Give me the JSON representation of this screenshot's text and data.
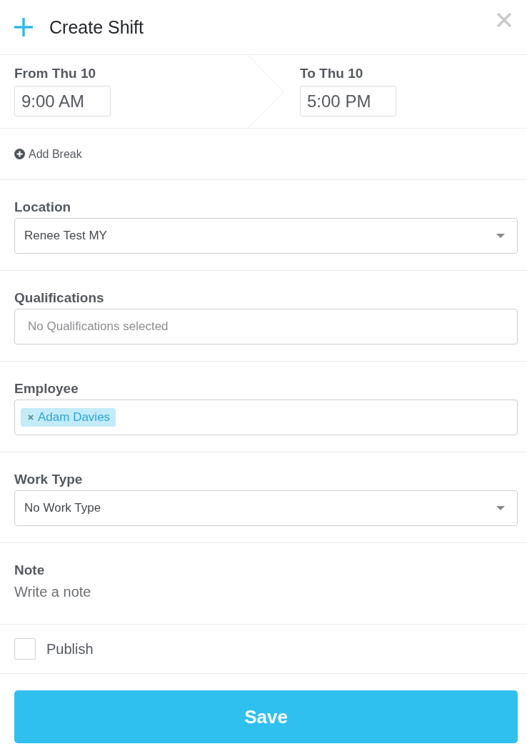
{
  "header": {
    "title": "Create Shift"
  },
  "shift_time": {
    "from": {
      "label": "From Thu 10",
      "value": "9:00 AM"
    },
    "to": {
      "label": "To Thu 10",
      "value": "5:00 PM"
    }
  },
  "add_break": {
    "label": "Add Break"
  },
  "fields": [
    {
      "kind": "select",
      "label": "Location",
      "value": "Renee Test MY"
    },
    {
      "kind": "multiselect",
      "label": "Qualifications",
      "placeholder": "No Qualifications selected"
    },
    {
      "kind": "tags",
      "label": "Employee",
      "tags": [
        {
          "label": "Adam Davies"
        }
      ]
    },
    {
      "kind": "select",
      "label": "Work Type",
      "value": "No Work Type"
    }
  ],
  "note": {
    "label": "Note",
    "placeholder": "Write a note"
  },
  "publish": {
    "label": "Publish",
    "checked": false
  },
  "save_button": {
    "label": "Save"
  }
}
